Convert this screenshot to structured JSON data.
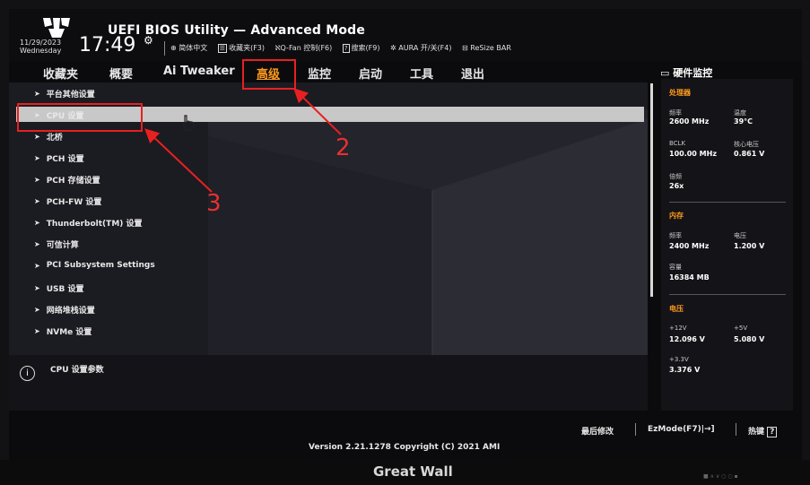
{
  "header": {
    "title": "UEFI BIOS Utility — Advanced Mode",
    "date": "11/29/2023",
    "weekday": "Wednesday",
    "time": "17:49",
    "tools": [
      {
        "icon": "globe-icon",
        "label": "简体中文"
      },
      {
        "icon": "favorites-icon",
        "label": "收藏夹(F3)"
      },
      {
        "icon": "fan-icon",
        "label": "Q-Fan 控制(F6)"
      },
      {
        "icon": "help-icon",
        "label": "搜索(F9)"
      },
      {
        "icon": "aura-icon",
        "label": "AURA 开/关(F4)"
      },
      {
        "icon": "resize-bar-icon",
        "label": "ReSize BAR"
      }
    ]
  },
  "nav": {
    "tabs": [
      "收藏夹",
      "概要",
      "Ai Tweaker",
      "高级",
      "监控",
      "启动",
      "工具",
      "退出"
    ],
    "active": "高级"
  },
  "menu": {
    "items": [
      "平台其他设置",
      "CPU 设置",
      "北桥",
      "PCH 设置",
      "PCH 存储设置",
      "PCH-FW 设置",
      "Thunderbolt(TM) 设置",
      "可信计算",
      "PCI Subsystem Settings",
      "USB 设置",
      "网络堆栈设置",
      "NVMe 设置"
    ],
    "selected": "CPU 设置"
  },
  "info": {
    "text": "CPU 设置参数"
  },
  "hardware": {
    "title": "硬件监控",
    "cpu": {
      "section": "处理器",
      "freq_label": "频率",
      "freq": "2600 MHz",
      "temp_label": "温度",
      "temp": "39°C",
      "bclk_label": "BCLK",
      "bclk": "100.00 MHz",
      "vcore_label": "核心电压",
      "vcore": "0.861 V",
      "ratio_label": "倍频",
      "ratio": "26x"
    },
    "memory": {
      "section": "内存",
      "freq_label": "频率",
      "freq": "2400 MHz",
      "volt_label": "电压",
      "volt": "1.200 V",
      "cap_label": "容量",
      "cap": "16384 MB"
    },
    "voltage": {
      "section": "电压",
      "v12_label": "+12V",
      "v12": "12.096 V",
      "v5_label": "+5V",
      "v5": "5.080 V",
      "v33_label": "+3.3V",
      "v33": "3.376 V"
    }
  },
  "footer": {
    "last_modified": "最后修改",
    "ezmode": "EzMode(F7)|→]",
    "hotkeys": "热键",
    "hotkey_icon": "?",
    "version": "Version 2.21.1278 Copyright (C) 2021 AMI"
  },
  "monitor": {
    "brand": "Great Wall"
  },
  "annotations": {
    "step2": "2",
    "step3": "3"
  },
  "colors": {
    "accent": "#ff9a1e",
    "annotation": "#e82020",
    "highlight": "#c8c8c8"
  }
}
